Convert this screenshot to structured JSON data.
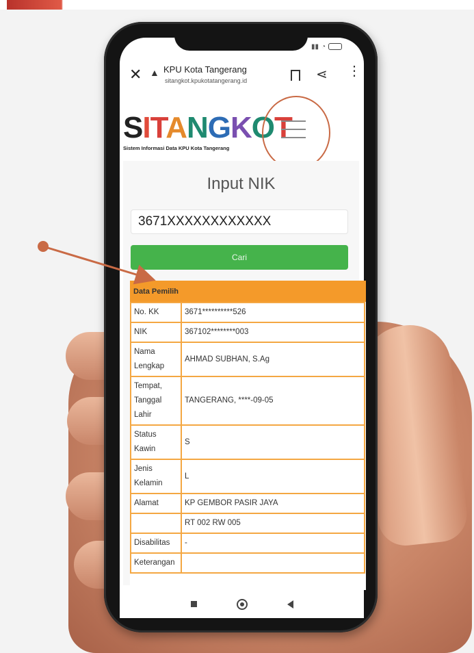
{
  "browser": {
    "close_icon": "close-icon",
    "warning_icon": "warning-icon",
    "site_title": "KPU Kota Tangerang",
    "site_url": "sitangkot.kpukotatangerang.id"
  },
  "logo": {
    "tagline": "Sistem Informasi Data KPU Kota Tangerang"
  },
  "form": {
    "title": "Input NIK",
    "nik_value": "3671XXXXXXXXXXXX",
    "button_label": "Cari"
  },
  "table": {
    "header": "Data Pemilih",
    "rows": [
      {
        "label": "No. KK",
        "value": "3671**********526"
      },
      {
        "label": "NIK",
        "value": "367102********003"
      },
      {
        "label": "Nama Lengkap",
        "value": "AHMAD SUBHAN, S.Ag"
      },
      {
        "label": "Tempat, Tanggal Lahir",
        "value": "TANGERANG, ****-09-05"
      },
      {
        "label": "Status Kawin",
        "value": "S"
      },
      {
        "label": "Jenis Kelamin",
        "value": "L"
      },
      {
        "label": "Alamat",
        "value": "KP GEMBOR PASIR JAYA"
      },
      {
        "label": "",
        "value": "RT 002 RW 005"
      },
      {
        "label": "Disabilitas",
        "value": "-"
      },
      {
        "label": "Keterangan",
        "value": ""
      }
    ]
  },
  "colors": {
    "accent_orange": "#f49a2a",
    "button_green": "#45b34b",
    "annotation": "#c96a45"
  }
}
